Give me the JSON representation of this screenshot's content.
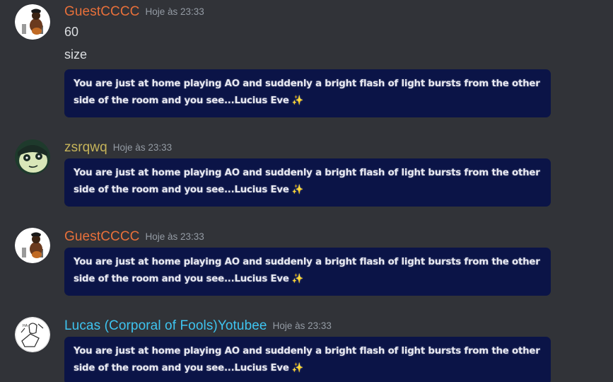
{
  "messages": [
    {
      "username": "GuestCCCC",
      "username_color": "#e8703a",
      "timestamp": "Hoje às 23:33",
      "lines": [
        "60",
        "size"
      ],
      "embed_text": "You are just at home playing AO and suddenly a bright flash of light bursts from the other side of the room and you see...Lucius Eve",
      "embed_icon": "sparkles-icon",
      "avatar": "guest-avatar"
    },
    {
      "username": "zsrqwq",
      "username_color": "#c6b45a",
      "timestamp": "Hoje às 23:33",
      "lines": [],
      "embed_text": "You are just at home playing AO and suddenly a bright flash of light bursts from the other side of the room and you see...Lucius Eve",
      "embed_icon": "sparkles-icon",
      "avatar": "zsrqwq-avatar"
    },
    {
      "username": "GuestCCCC",
      "username_color": "#e8703a",
      "timestamp": "Hoje às 23:33",
      "lines": [],
      "embed_text": "You are just at home playing AO and suddenly a bright flash of light bursts from the other side of the room and you see...Lucius Eve",
      "embed_icon": "sparkles-icon",
      "avatar": "guest-avatar"
    },
    {
      "username": "Lucas (Corporal of Fools)Yotubee",
      "username_color": "#3ec4f0",
      "timestamp": "Hoje às 23:33",
      "lines": [],
      "embed_text": "You are just at home playing AO and suddenly a bright flash of light bursts from the other side of the room and you see...Lucius Eve",
      "embed_icon": "sparkles-icon",
      "avatar": "lucas-avatar"
    }
  ],
  "colors": {
    "background": "#313338",
    "embed_background": "#0b1447",
    "timestamp": "#949ba4",
    "message_text": "#dbdee1"
  }
}
